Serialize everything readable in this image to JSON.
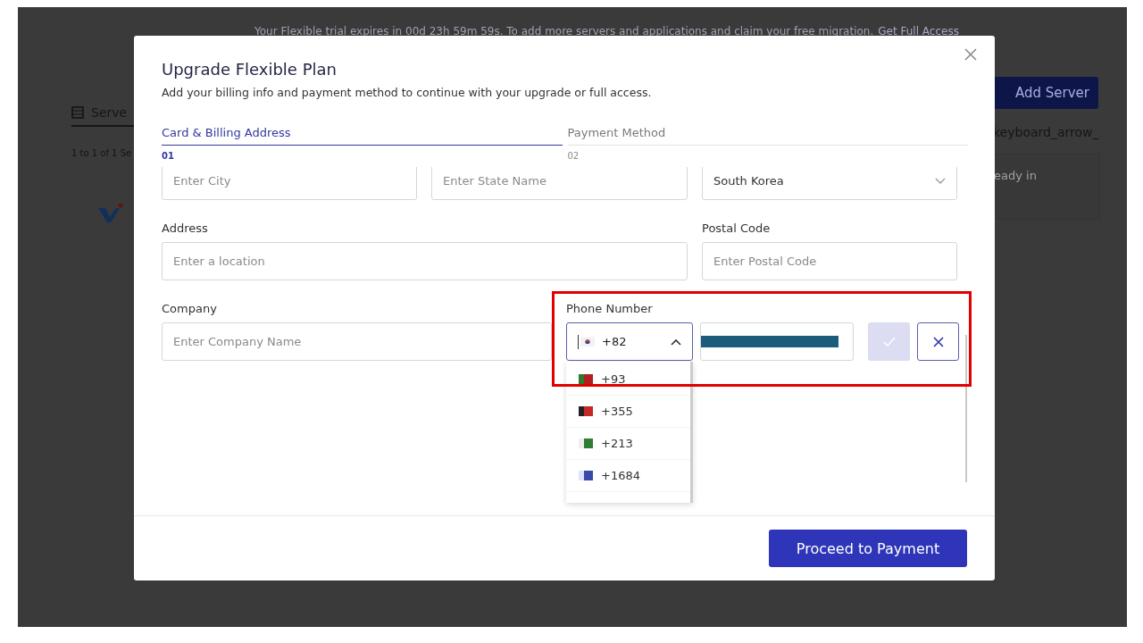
{
  "backdrop": {
    "trial_notice": "Your Flexible trial expires in 00d 23h 59m 59s. To add more servers and applications and claim your free migration.",
    "trial_link": "Get Full Access",
    "add_server_button": "Add Server",
    "servers_tab": "Serve",
    "count_text": "1 to 1 of 1 Se",
    "column_text": "keyboard_arrow_",
    "status_text": "eady in"
  },
  "dialog": {
    "title": "Upgrade Flexible Plan",
    "subtitle": "Add your billing info and payment method to continue with your upgrade or full access.",
    "steps": [
      {
        "label": "Card & Billing Address",
        "number": "01",
        "selected": true
      },
      {
        "label": "Payment Method",
        "number": "02",
        "selected": false
      }
    ],
    "fields": [
      {
        "kind": "input",
        "placeholder": "Enter City"
      },
      {
        "kind": "input",
        "placeholder": "Enter State Name"
      },
      {
        "kind": "select",
        "value": "South Korea"
      },
      {
        "kind": "input",
        "label": "Address",
        "placeholder": "Enter a location"
      },
      {
        "kind": "input",
        "label": "Postal Code",
        "placeholder": "Enter Postal Code"
      },
      {
        "kind": "input",
        "label": "Company",
        "placeholder": "Enter Company Name"
      },
      {
        "kind": "phone",
        "label": "Phone Number",
        "code": "+82",
        "expanded": true
      }
    ],
    "country_codes": [
      {
        "code": "+93",
        "selected": false
      },
      {
        "code": "+355",
        "selected": false
      },
      {
        "code": "+213",
        "selected": false
      },
      {
        "code": "+1684",
        "selected": false
      }
    ],
    "confirm_disabled": true,
    "primary_button": "Proceed to Payment"
  }
}
